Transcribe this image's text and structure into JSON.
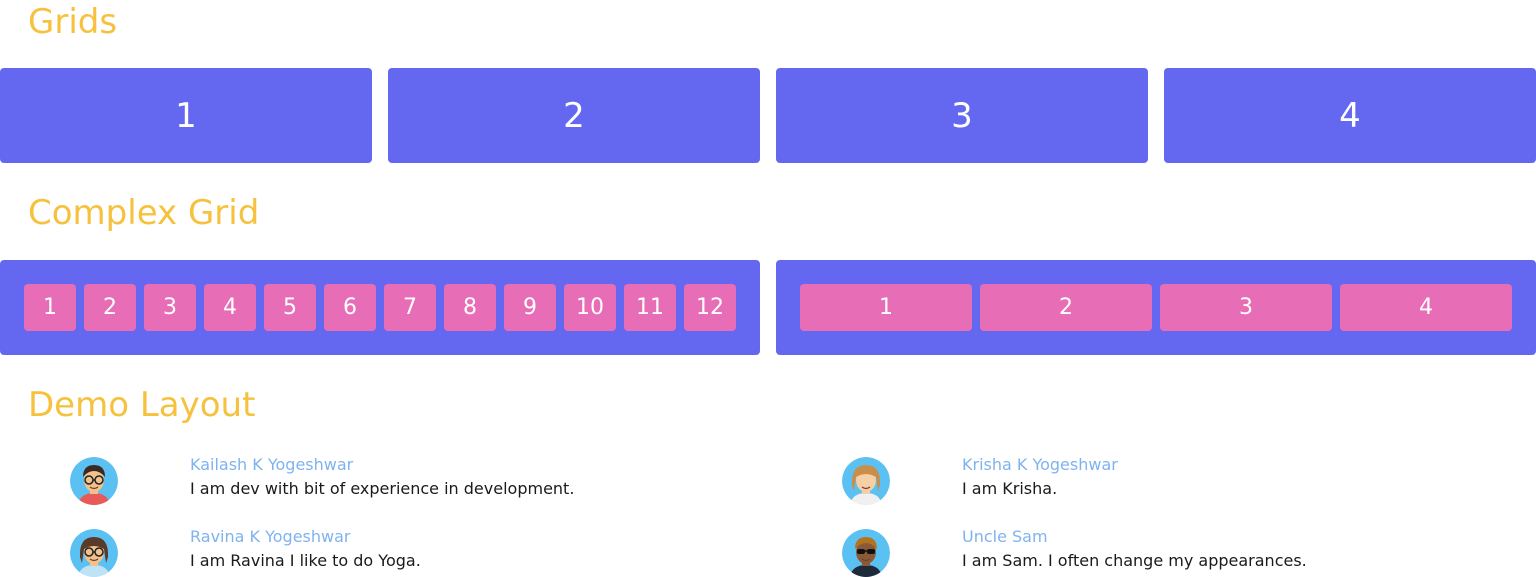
{
  "sections": {
    "grids_title": "Grids",
    "complex_title": "Complex Grid",
    "demo_title": "Demo Layout"
  },
  "grids": [
    "1",
    "2",
    "3",
    "4"
  ],
  "complex": {
    "left_cells": [
      "1",
      "2",
      "3",
      "4",
      "5",
      "6",
      "7",
      "8",
      "9",
      "10",
      "11",
      "12"
    ],
    "right_cells": [
      "1",
      "2",
      "3",
      "4"
    ]
  },
  "people": [
    {
      "name": "Kailash K Yogeshwar",
      "bio": "I am dev with bit of experience in development.",
      "avatar": "male-glasses-avatar-icon",
      "bg": "#5bc0f2",
      "skin": "#f2c18c",
      "hair": "#3b2a21",
      "shirt": "#e85a5a"
    },
    {
      "name": "Krisha K Yogeshwar",
      "bio": "I am Krisha.",
      "avatar": "female-blonde-avatar-icon",
      "bg": "#5bc0f2",
      "skin": "#f5cfa5",
      "hair": "#c98f4a",
      "shirt": "#f0f0f0"
    },
    {
      "name": "Ravina K Yogeshwar",
      "bio": "I am Ravina I like to do Yoga.",
      "avatar": "female-glasses-avatar-icon",
      "bg": "#5bc0f2",
      "skin": "#f2c18c",
      "hair": "#5a3a28",
      "shirt": "#bfe3f5"
    },
    {
      "name": "Uncle Sam",
      "bio": "I am Sam. I often change my appearances.",
      "avatar": "male-sunglasses-avatar-icon",
      "bg": "#5bc0f2",
      "skin": "#8a5a36",
      "hair": "#b4741f",
      "shirt": "#1d2a3a"
    }
  ]
}
